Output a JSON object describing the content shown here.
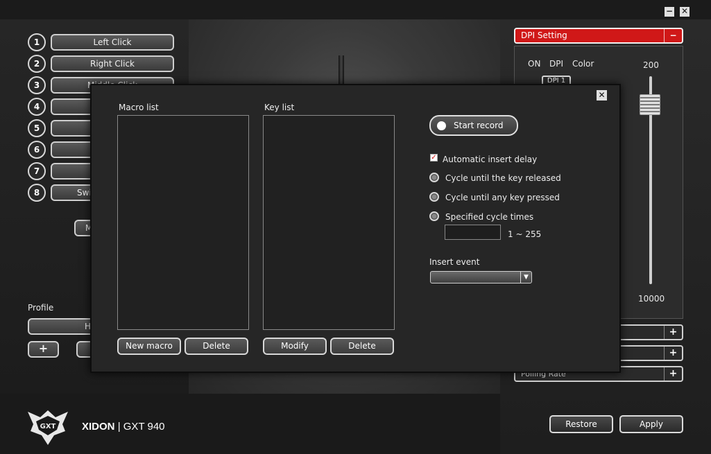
{
  "window": {
    "minimize_label": "−",
    "close_label": "✕"
  },
  "keys": [
    {
      "number": "1",
      "label": "Left Click"
    },
    {
      "number": "2",
      "label": "Right Click"
    },
    {
      "number": "3",
      "label": "Middle Click"
    },
    {
      "number": "4",
      "label": ""
    },
    {
      "number": "5",
      "label": ""
    },
    {
      "number": "6",
      "label": ""
    },
    {
      "number": "7",
      "label": ""
    },
    {
      "number": "8",
      "label": "Swi"
    }
  ],
  "left": {
    "macro_button_label": "M",
    "profile_label": "Profile",
    "profile_value": "H",
    "add_profile_label": "+"
  },
  "dpi": {
    "header": "DPI Setting",
    "collapse_label": "−",
    "col_on": "ON",
    "col_dpi": "DPI",
    "col_color": "Color",
    "first_level": "DPI 1",
    "slider_top": "200",
    "slider_bottom": "10000"
  },
  "side_rows": [
    {
      "label": "",
      "action": "+"
    },
    {
      "label": "",
      "action": "+"
    },
    {
      "label": "Polling Rate",
      "action": "+"
    }
  ],
  "footer": {
    "restore_label": "Restore",
    "apply_label": "Apply"
  },
  "brand": {
    "name": "XIDON",
    "separator": "|",
    "model": "GXT 940",
    "logo_text": "GXT"
  },
  "modal": {
    "close_label": "✕",
    "macro_list_label": "Macro list",
    "key_list_label": "Key list",
    "new_macro_label": "New macro",
    "delete_macro_label": "Delete",
    "modify_label": "Modify",
    "delete_key_label": "Delete",
    "start_record_label": "Start record",
    "auto_delay_label": "Automatic insert delay",
    "auto_delay_checked": true,
    "options": [
      "Cycle until the key released",
      "Cycle until any key pressed",
      "Specified cycle times"
    ],
    "cycle_range": "1 ~ 255",
    "insert_event_label": "Insert event",
    "insert_event_value": ""
  },
  "colors": {
    "accent": "#d01818",
    "modal_bg": "#262626"
  }
}
